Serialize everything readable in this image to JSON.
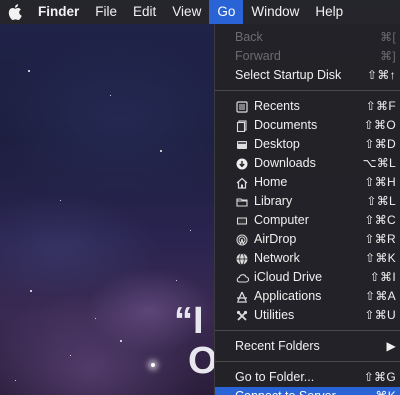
{
  "menubar": {
    "apple_icon": "apple-logo-icon",
    "items": [
      "Finder",
      "File",
      "Edit",
      "View",
      "Go",
      "Window",
      "Help"
    ]
  },
  "background_text": {
    "line1": "“I",
    "line2": "O"
  },
  "go_menu": {
    "back": {
      "label": "Back",
      "shortcut": "⌘["
    },
    "forward": {
      "label": "Forward",
      "shortcut": "⌘]"
    },
    "startup": {
      "label": "Select Startup Disk",
      "shortcut": "⇧⌘↑"
    },
    "places": [
      {
        "label": "Recents",
        "shortcut": "⇧⌘F",
        "icon": "recents-icon"
      },
      {
        "label": "Documents",
        "shortcut": "⇧⌘O",
        "icon": "documents-icon"
      },
      {
        "label": "Desktop",
        "shortcut": "⇧⌘D",
        "icon": "desktop-icon"
      },
      {
        "label": "Downloads",
        "shortcut": "⌥⌘L",
        "icon": "downloads-icon"
      },
      {
        "label": "Home",
        "shortcut": "⇧⌘H",
        "icon": "home-icon"
      },
      {
        "label": "Library",
        "shortcut": "⇧⌘L",
        "icon": "library-folder-icon"
      },
      {
        "label": "Computer",
        "shortcut": "⇧⌘C",
        "icon": "computer-icon"
      },
      {
        "label": "AirDrop",
        "shortcut": "⇧⌘R",
        "icon": "airdrop-icon"
      },
      {
        "label": "Network",
        "shortcut": "⇧⌘K",
        "icon": "network-icon"
      },
      {
        "label": "iCloud Drive",
        "shortcut": "⇧⌘I",
        "icon": "icloud-icon"
      },
      {
        "label": "Applications",
        "shortcut": "⇧⌘A",
        "icon": "applications-icon"
      },
      {
        "label": "Utilities",
        "shortcut": "⇧⌘U",
        "icon": "utilities-icon"
      }
    ],
    "recent_folders": {
      "label": "Recent Folders",
      "submenu_arrow": "▶"
    },
    "go_to_folder": {
      "label": "Go to Folder...",
      "shortcut": "⇧⌘G"
    },
    "connect_server": {
      "label": "Connect to Server...",
      "shortcut": "⌘K"
    }
  },
  "colors": {
    "highlight": "#2a63d6",
    "menubar": "#26262a",
    "menu": "#222226"
  }
}
